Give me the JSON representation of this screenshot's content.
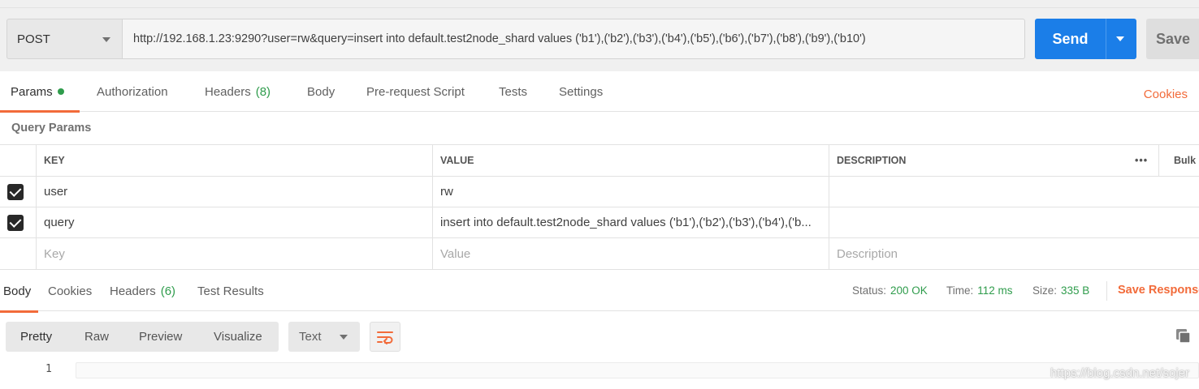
{
  "request": {
    "method": "POST",
    "url": "http://192.168.1.23:9290?user=rw&query=insert into default.test2node_shard values ('b1'),('b2'),('b3'),('b4'),('b5'),('b6'),('b7'),('b8'),('b9'),('b10')",
    "send_label": "Send",
    "save_label": "Save"
  },
  "request_tabs": {
    "params": "Params",
    "authorization": "Authorization",
    "headers": "Headers",
    "headers_count": "(8)",
    "body": "Body",
    "prerequest": "Pre-request Script",
    "tests": "Tests",
    "settings": "Settings",
    "cookies": "Cookies"
  },
  "query_params": {
    "title": "Query Params",
    "columns": {
      "key": "KEY",
      "value": "VALUE",
      "description": "DESCRIPTION"
    },
    "more": "•••",
    "bulk_edit": "Bulk",
    "rows": [
      {
        "key": "user",
        "value": "rw",
        "description": "",
        "checked": true
      },
      {
        "key": "query",
        "value": "insert into default.test2node_shard values ('b1'),('b2'),('b3'),('b4'),('b...",
        "description": "",
        "checked": true
      }
    ],
    "placeholders": {
      "key": "Key",
      "value": "Value",
      "description": "Description"
    }
  },
  "response_tabs": {
    "body": "Body",
    "cookies": "Cookies",
    "headers": "Headers",
    "headers_count": "(6)",
    "test_results": "Test Results"
  },
  "response_meta": {
    "status_label": "Status:",
    "status_value": "200 OK",
    "time_label": "Time:",
    "time_value": "112 ms",
    "size_label": "Size:",
    "size_value": "335 B",
    "save_response": "Save Response"
  },
  "response_toolbar": {
    "modes": [
      "Pretty",
      "Raw",
      "Preview",
      "Visualize"
    ],
    "selected_mode": "Pretty",
    "format": "Text"
  },
  "editor": {
    "line_number": "1"
  },
  "watermark": "https://blog.csdn.net/sojer",
  "colors": {
    "accent": "#f26b3a",
    "send_blue": "#1b7ee8",
    "success_green": "#2f9c4c"
  }
}
